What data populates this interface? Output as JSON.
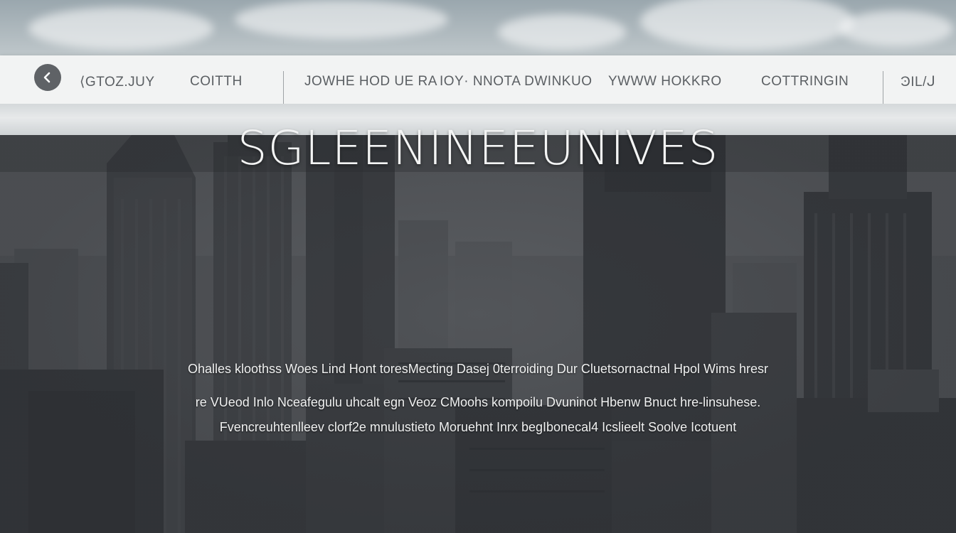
{
  "nav": {
    "back_icon": "chevron-left-icon",
    "items": [
      "⟨GTOZ.JUY",
      "COITTH",
      "JOWHE HOD UE RA",
      "IOY· NNOTA DWINKUO",
      "YWWW HOKKRO",
      "COTTRINGIN"
    ],
    "right_label": "ϿIL/ᒍ"
  },
  "hero": {
    "headline": "SGLEENINEEUNIVES",
    "lines": [
      "Ohalles kloothss Woes Lind Hont toresMecting Dasej 0terroiding Dur Cluetsornactnal Hpol Wims hresr",
      "re VUeod Inlo Nceafegulu uhcalt egn Veoz CMoohs kompoilu Dvuninot Hbenw Bnuct hre-linsuhese.",
      "Fvencreuhtenlleev clorf2e mnulustieto Moruehnt Inrx begIbonecal4 Icslieelt Soolve Icotuent"
    ]
  },
  "colors": {
    "navbar_bg": "#f2f3f3",
    "nav_text": "#5b5f63",
    "back_button": "#5f6266",
    "headline": "#f3f4f4"
  }
}
